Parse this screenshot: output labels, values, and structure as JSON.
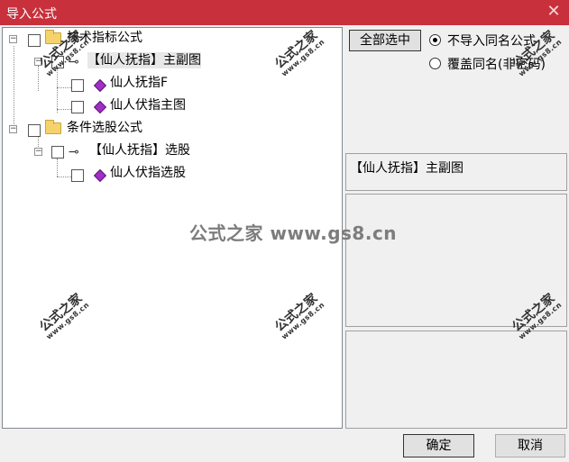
{
  "window": {
    "title": "导入公式",
    "close_glyph": "✕"
  },
  "tree": {
    "group1": {
      "label": "技术指标公式",
      "child": {
        "label": "【仙人抚指】主副图",
        "items": [
          "仙人抚指F",
          "仙人伏指主图"
        ]
      }
    },
    "group2": {
      "label": "条件选股公式",
      "child": {
        "label": "【仙人抚指】选股",
        "items": [
          "仙人伏指选股"
        ]
      }
    },
    "expander_glyph": "−"
  },
  "options": {
    "select_all_label": "全部选中",
    "radio_skip_label": "不导入同名公式",
    "radio_overwrite_label": "覆盖同名(非密码)",
    "selected_radio": "不导入同名公式"
  },
  "selected_formula_name": "【仙人抚指】主副图",
  "buttons": {
    "ok": "确定",
    "cancel": "取消"
  },
  "watermark": {
    "logo": "公式之家",
    "url": "www.gs8.cn",
    "center": "公式之家 www.gs8.cn"
  },
  "icons": [
    "close-icon",
    "folder-icon",
    "key-icon",
    "formula-icon",
    "expander-icon"
  ],
  "colors": {
    "titlebar": "#c8313c",
    "window_bg": "#f0f0f0",
    "formula_gem": "#a12ec8",
    "folder": "#f6d36a"
  }
}
